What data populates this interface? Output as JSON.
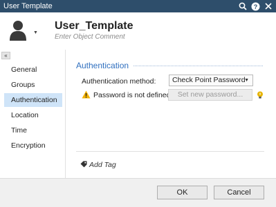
{
  "window": {
    "title": "User Template"
  },
  "header": {
    "object_name": "User_Template",
    "comment_placeholder": "Enter Object Comment"
  },
  "sidebar": {
    "collapse_label": "«",
    "items": [
      {
        "label": "General",
        "active": false
      },
      {
        "label": "Groups",
        "active": false
      },
      {
        "label": "Authentication",
        "active": true
      },
      {
        "label": "Location",
        "active": false
      },
      {
        "label": "Time",
        "active": false
      },
      {
        "label": "Encryption",
        "active": false
      }
    ]
  },
  "main": {
    "section_title": "Authentication",
    "auth_method_label": "Authentication method:",
    "auth_method_value": "Check Point Password",
    "warning_text": "Password is not defined",
    "set_password_button": "Set new password...",
    "add_tag_label": "Add Tag"
  },
  "footer": {
    "ok_label": "OK",
    "cancel_label": "Cancel"
  },
  "colors": {
    "titlebar": "#2e4e6b",
    "accent": "#2f6fbf",
    "selected_item": "#cfe4f8",
    "warning": "#f2b100"
  },
  "icons": [
    "search-icon",
    "help-icon",
    "close-icon",
    "user-avatar-icon",
    "warning-icon",
    "lightbulb-icon",
    "tag-icon"
  ]
}
